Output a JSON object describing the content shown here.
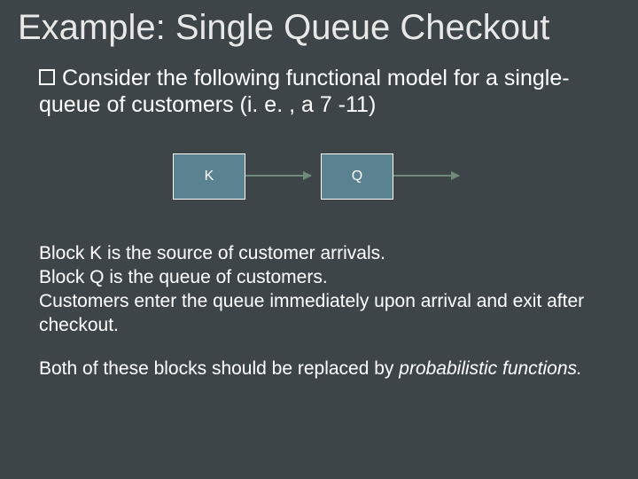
{
  "slide": {
    "title": "Example: Single Queue Checkout",
    "intro_lead": "Consider",
    "intro_rest": " the following functional model for a single-queue of customers (i. e. , a 7 -11)",
    "block_k_label": "K",
    "block_q_label": "Q",
    "desc_line1": "Block K is the source of customer arrivals.",
    "desc_line2": "Block Q is the queue of customers.",
    "desc_line3": "Customers enter the queue immediately upon arrival and exit after checkout.",
    "desc_p2_a": "Both of these blocks should be replaced by ",
    "desc_p2_b": "probabilistic functions.",
    "desc_p2_c": ""
  }
}
